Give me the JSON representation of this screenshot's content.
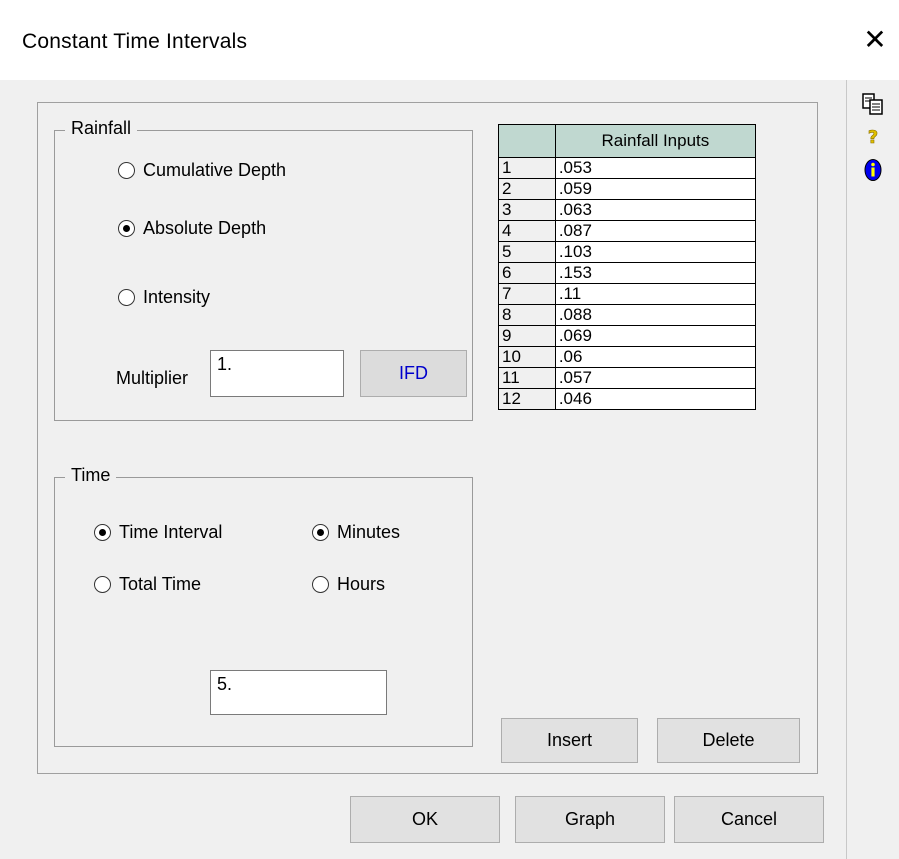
{
  "window": {
    "title": "Constant Time Intervals",
    "close_glyph": "✕"
  },
  "rainfall": {
    "legend": "Rainfall",
    "options": [
      {
        "label": "Cumulative Depth",
        "selected": false
      },
      {
        "label": "Absolute Depth",
        "selected": true
      },
      {
        "label": "Intensity",
        "selected": false
      }
    ],
    "multiplier_label": "Multiplier",
    "multiplier_value": "1.",
    "ifd_label": "IFD"
  },
  "time": {
    "legend": "Time",
    "mode_options": [
      {
        "label": "Time Interval",
        "selected": true
      },
      {
        "label": "Total Time",
        "selected": false
      }
    ],
    "unit_options": [
      {
        "label": "Minutes",
        "selected": true
      },
      {
        "label": "Hours",
        "selected": false
      }
    ],
    "value": "5."
  },
  "table": {
    "column_header": "Rainfall Inputs",
    "rows": [
      {
        "n": "1",
        "v": ".053"
      },
      {
        "n": "2",
        "v": ".059"
      },
      {
        "n": "3",
        "v": ".063"
      },
      {
        "n": "4",
        "v": ".087"
      },
      {
        "n": "5",
        "v": ".103"
      },
      {
        "n": "6",
        "v": ".153"
      },
      {
        "n": "7",
        "v": ".11"
      },
      {
        "n": "8",
        "v": ".088"
      },
      {
        "n": "9",
        "v": ".069"
      },
      {
        "n": "10",
        "v": ".06"
      },
      {
        "n": "11",
        "v": ".057"
      },
      {
        "n": "12",
        "v": ".046"
      }
    ]
  },
  "buttons": {
    "insert": "Insert",
    "delete": "Delete",
    "ok": "OK",
    "graph": "Graph",
    "cancel": "Cancel"
  },
  "rail_icons": [
    "copy-icon",
    "help-icon",
    "info-icon"
  ],
  "colors": {
    "ifd_text": "#0000cc",
    "table_header_bg": "#c0d8d0",
    "info_blue": "#0000ee",
    "help_yellow": "#e0c000"
  }
}
